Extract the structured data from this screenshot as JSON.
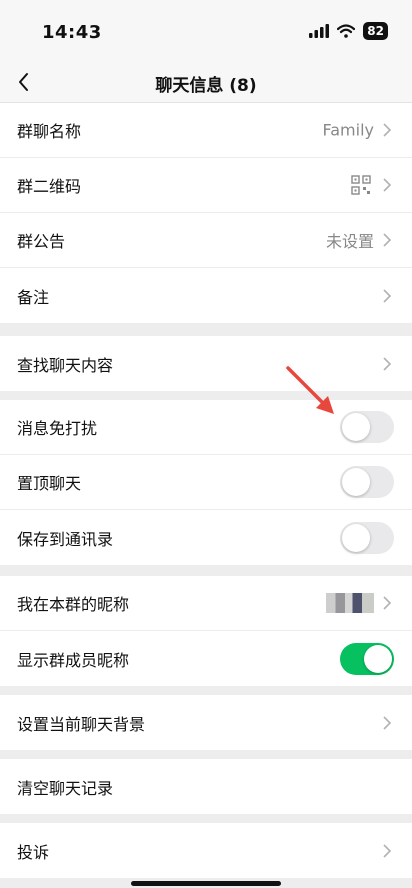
{
  "status_bar": {
    "time": "14:43",
    "battery": "82"
  },
  "nav": {
    "title": "聊天信息 (8)"
  },
  "groups": {
    "info": [
      {
        "label": "群聊名称",
        "value": "Family"
      },
      {
        "label": "群二维码"
      },
      {
        "label": "群公告",
        "value": "未设置"
      },
      {
        "label": "备注"
      }
    ],
    "search": {
      "label": "查找聊天内容"
    },
    "toggles": [
      {
        "label": "消息免打扰",
        "on": false
      },
      {
        "label": "置顶聊天",
        "on": false
      },
      {
        "label": "保存到通讯录",
        "on": false
      }
    ],
    "nickname": [
      {
        "label": "我在本群的昵称"
      },
      {
        "label": "显示群成员昵称",
        "on": true
      }
    ],
    "background": {
      "label": "设置当前聊天背景"
    },
    "clear": {
      "label": "清空聊天记录"
    },
    "report": {
      "label": "投诉"
    }
  },
  "colors": {
    "toggle_on": "#07c160",
    "annotation_arrow": "#e8473d"
  }
}
